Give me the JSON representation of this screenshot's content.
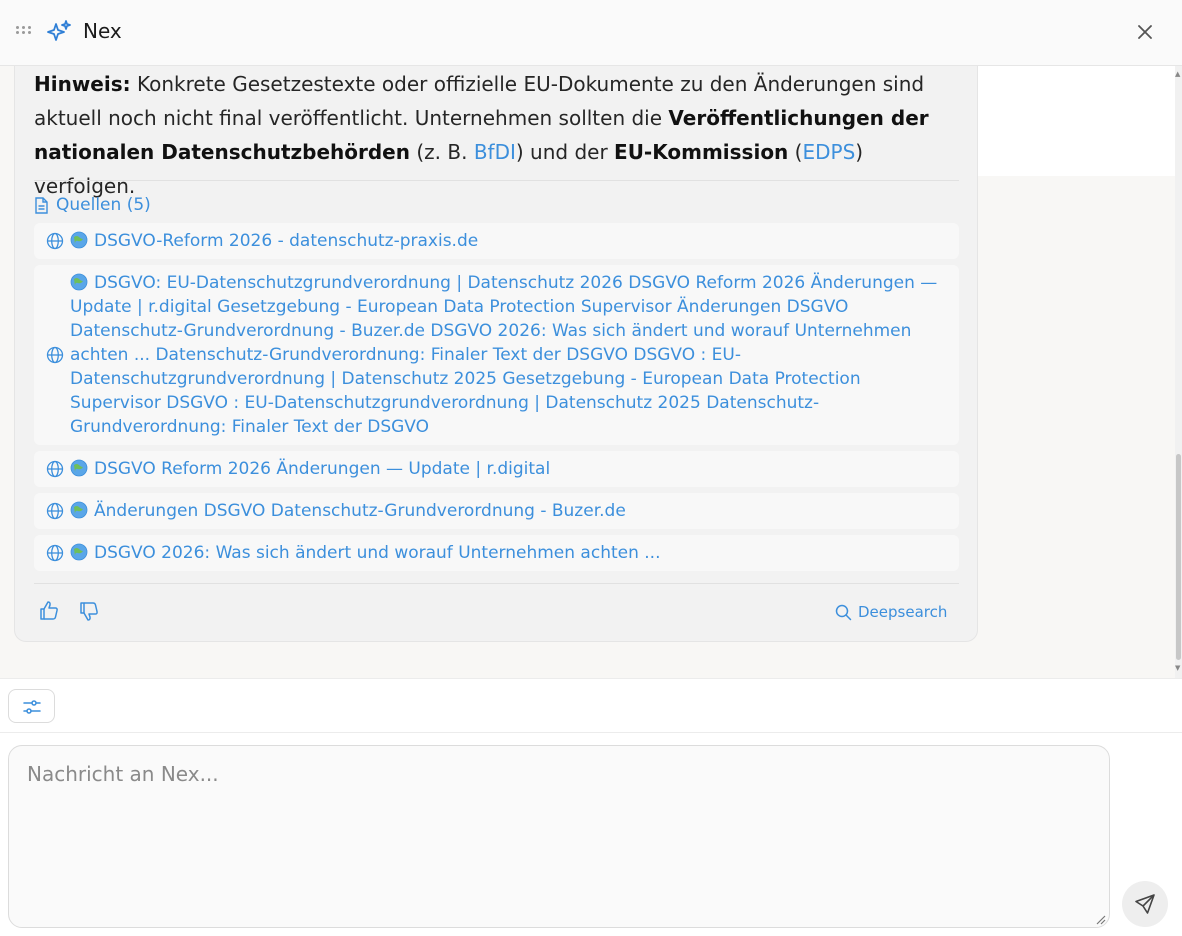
{
  "header": {
    "title": "Nex",
    "icons": {
      "drag": "drag-handle-icon",
      "logo": "sparkle-icon",
      "close": "close-icon"
    }
  },
  "message": {
    "note": {
      "label": "Hinweis:",
      "text1": " Konkrete Gesetzestexte oder offizielle EU-Dokumente zu den Änderungen sind aktuell noch nicht final veröffentlicht. Unternehmen sollten die ",
      "bold1": "Veröffentlichungen der nationalen Datenschutzbehörden",
      "text2": " (z. B. ",
      "link1": "BfDI",
      "text3": ") und der ",
      "bold2": "EU-Kommission",
      "text4": " (",
      "link2": "EDPS",
      "text5": ") verfolgen."
    },
    "sources": {
      "label": "Quellen (5)",
      "items": [
        {
          "title": "DSGVO-Reform 2026 - datenschutz-praxis.de"
        },
        {
          "title": "DSGVO: EU-Datenschutzgrundverordnung | Datenschutz 2026 DSGVO Reform 2026 Änderungen — Update | r.digital Gesetzgebung - European Data Protection Supervisor Änderungen DSGVO Datenschutz-Grundverordnung - Buzer.de DSGVO 2026: Was sich ändert und worauf Unternehmen achten ... Datenschutz-Grundverordnung: Finaler Text der DSGVO DSGVO : EU-Datenschutzgrundverordnung | Datenschutz 2025 Gesetzgebung - European Data Protection Supervisor DSGVO : EU-Datenschutzgrundverordnung | Datenschutz 2025 Datenschutz-Grundverordnung: Finaler Text der DSGVO"
        },
        {
          "title": "DSGVO Reform 2026 Änderungen — Update | r.digital"
        },
        {
          "title": "Änderungen DSGVO Datenschutz-Grundverordnung - Buzer.de"
        },
        {
          "title": "DSGVO 2026: Was sich ändert und worauf Unternehmen achten ..."
        }
      ]
    },
    "actions": {
      "deepsearch": "Deepsearch",
      "icons": {
        "thumbs_up": "thumbs-up-icon",
        "thumbs_down": "thumbs-down-icon",
        "search": "search-icon"
      }
    }
  },
  "composer": {
    "placeholder": "Nachricht an Nex...",
    "icons": {
      "settings": "sliders-icon",
      "send": "send-icon"
    }
  },
  "colors": {
    "accent": "#3c8fdc",
    "card_bg": "#f2f2f2",
    "page_bg": "#f8f7f5"
  }
}
